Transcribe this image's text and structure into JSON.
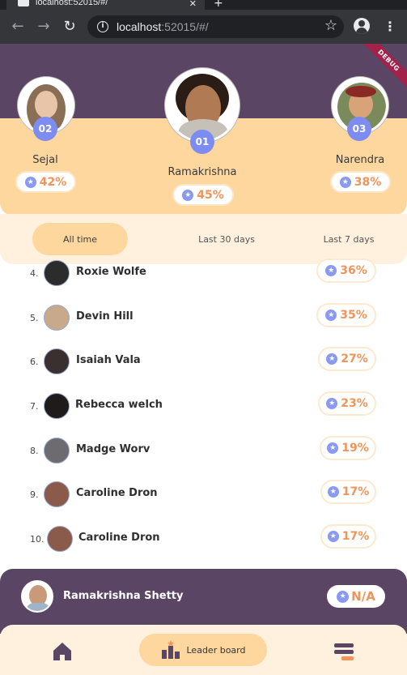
{
  "browser": {
    "tab_title": "localhost:52015/#/",
    "tab_close": "✕",
    "new_tab": "+",
    "url_host": "localhost",
    "url_rest": ":52015/#/",
    "back": "←",
    "forward": "→",
    "reload": "↻",
    "star": "☆",
    "menu": "⋮"
  },
  "app": {
    "debug_label": "DEBUG",
    "podium": [
      {
        "rank": "02",
        "name": "Sejal",
        "percent": "42%"
      },
      {
        "rank": "01",
        "name": "Ramakrishna",
        "percent": "45%"
      },
      {
        "rank": "03",
        "name": "Narendra",
        "percent": "38%"
      }
    ],
    "tabs": [
      {
        "label": "All time",
        "active": true
      },
      {
        "label": "Last 30 days",
        "active": false
      },
      {
        "label": "Last 7 days",
        "active": false
      }
    ],
    "rows": [
      {
        "rank": "4.",
        "name": "Roxie Wolfe",
        "percent": "36%"
      },
      {
        "rank": "5.",
        "name": "Devin Hill",
        "percent": "35%"
      },
      {
        "rank": "6.",
        "name": "Isaiah Vala",
        "percent": "27%"
      },
      {
        "rank": "7.",
        "name": "Rebecca welch",
        "percent": "23%"
      },
      {
        "rank": "8.",
        "name": "Madge Worv",
        "percent": "19%"
      },
      {
        "rank": "9.",
        "name": "Caroline Dron",
        "percent": "17%"
      },
      {
        "rank": "10.",
        "name": "Caroline Dron",
        "percent": "17%"
      }
    ],
    "current_user": {
      "name": "Ramakrishna Shetty",
      "percent": "N/A"
    },
    "nav": {
      "leaderboard_label": "Leader board"
    },
    "colors": {
      "purple": "#5b4564",
      "peach": "#fed79f",
      "cream": "#fff1de",
      "accent": "#f0945a",
      "badge": "#7d8cf0"
    }
  }
}
